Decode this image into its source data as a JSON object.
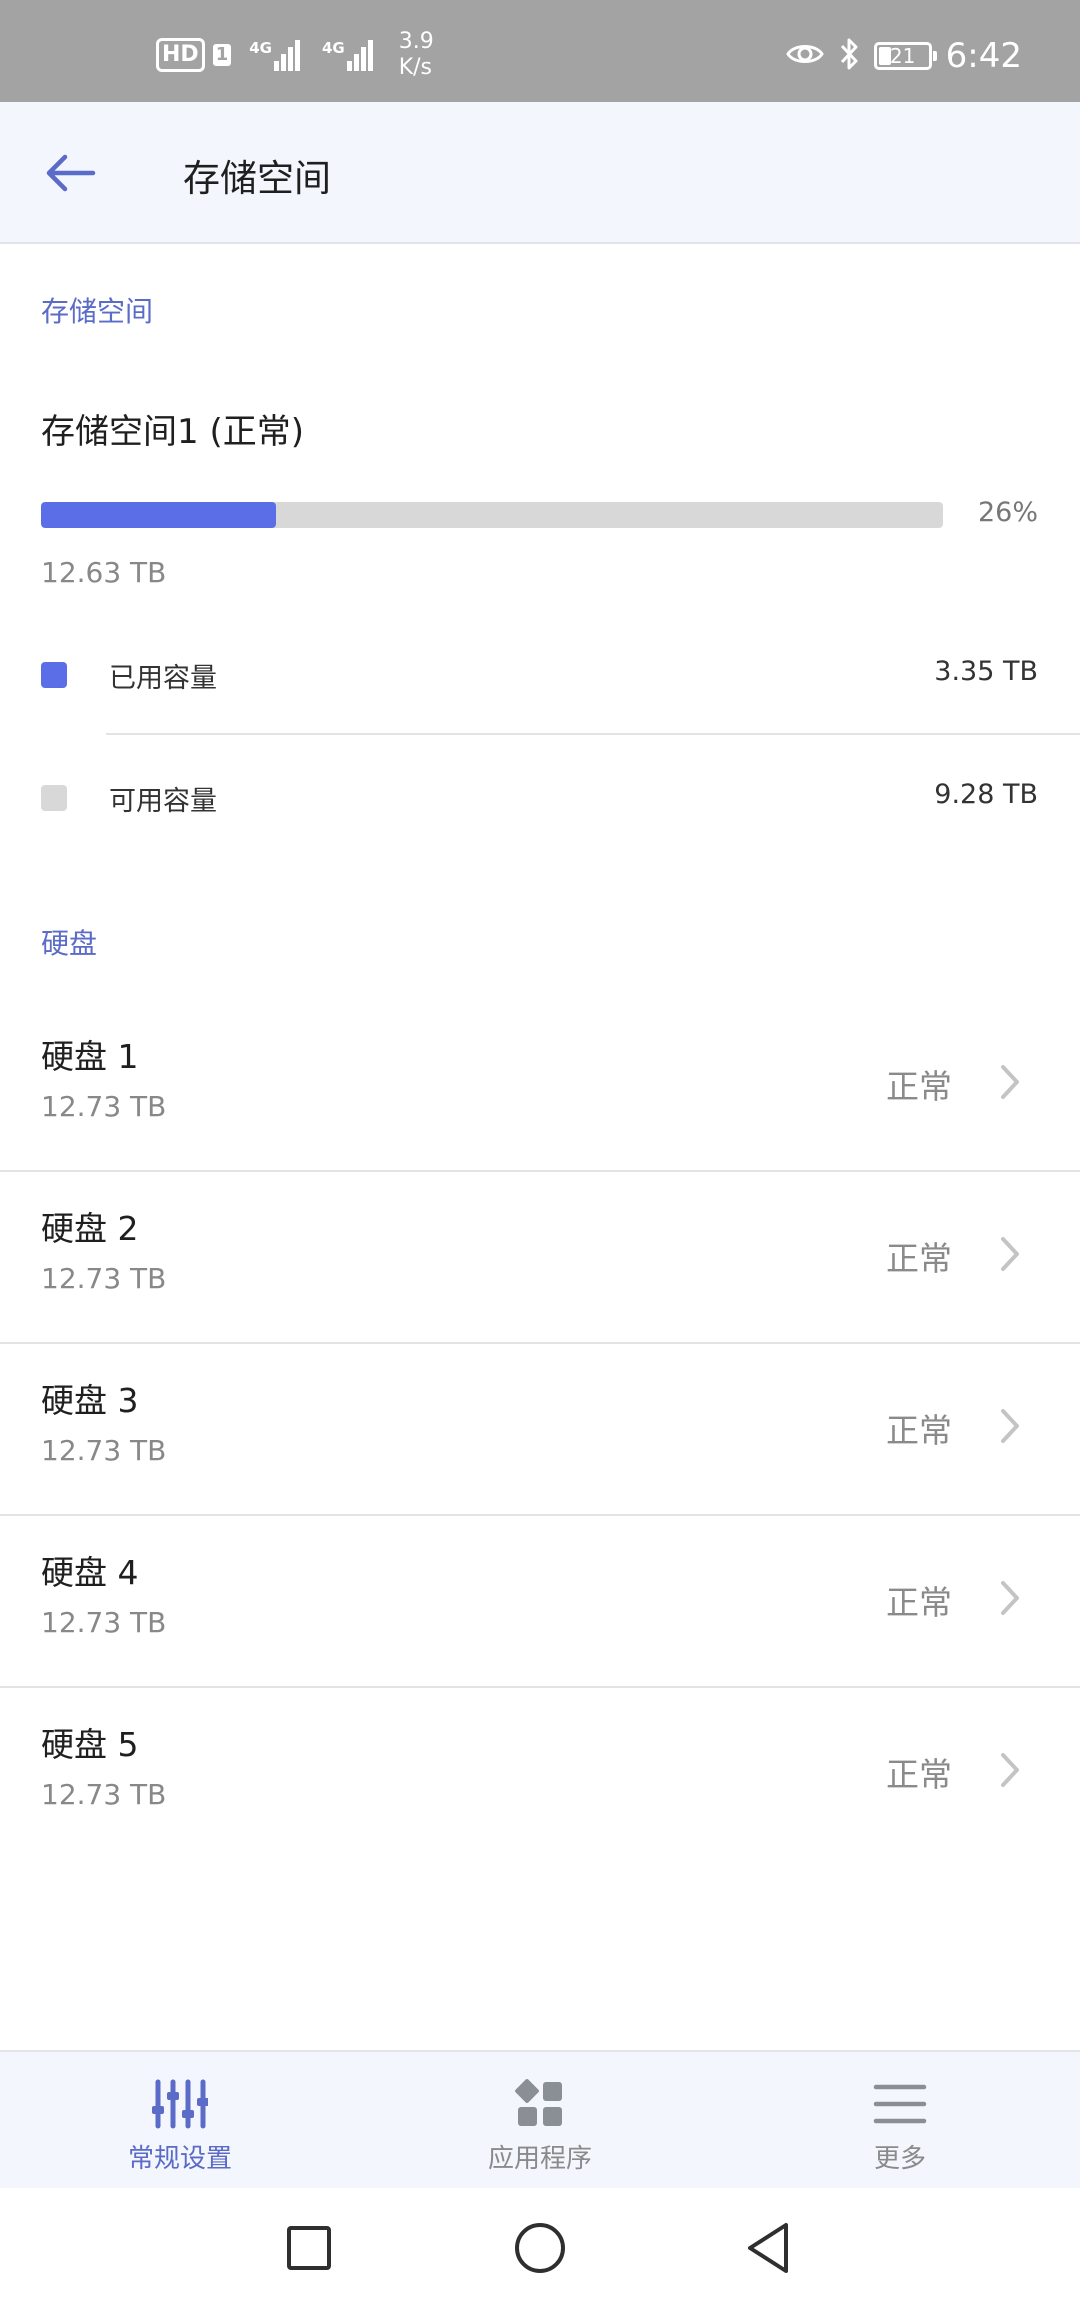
{
  "status_bar": {
    "hd": "HD",
    "sim": "1",
    "net1": "4G",
    "net2": "4G",
    "speed_value": "3.9",
    "speed_unit": "K/s",
    "battery": "21",
    "time": "6:42"
  },
  "header": {
    "title": "存储空间",
    "back_icon": "arrow-left-icon"
  },
  "storage": {
    "section_title": "存储空间",
    "pool_name": "存储空间1 (正常)",
    "usage_percent": 26,
    "usage_label": "26%",
    "total": "12.63 TB",
    "legend": [
      {
        "label": "已用容量",
        "value": "3.35 TB",
        "color": "#5b6ee8"
      },
      {
        "label": "可用容量",
        "value": "9.28 TB",
        "color": "#d8d8d8"
      }
    ]
  },
  "disks": {
    "section_title": "硬盘",
    "items": [
      {
        "name": "硬盘 1",
        "size": "12.73 TB",
        "status": "正常"
      },
      {
        "name": "硬盘 2",
        "size": "12.73 TB",
        "status": "正常"
      },
      {
        "name": "硬盘 3",
        "size": "12.73 TB",
        "status": "正常"
      },
      {
        "name": "硬盘 4",
        "size": "12.73 TB",
        "status": "正常"
      },
      {
        "name": "硬盘 5",
        "size": "12.73 TB",
        "status": "正常"
      }
    ]
  },
  "bottom_nav": {
    "items": [
      {
        "label": "常规设置",
        "icon": "sliders-icon",
        "active": true
      },
      {
        "label": "应用程序",
        "icon": "apps-grid-icon",
        "active": false
      },
      {
        "label": "更多",
        "icon": "menu-icon",
        "active": false
      }
    ]
  },
  "system_nav": {
    "recent": "square-icon",
    "home": "circle-icon",
    "back": "triangle-back-icon"
  },
  "colors": {
    "accent": "#5a6bc8",
    "progress_fill": "#5b6ee8",
    "progress_track": "#d8d8d8",
    "status_bar": "#a3a3a3",
    "header_bg": "#f3f6fd"
  }
}
